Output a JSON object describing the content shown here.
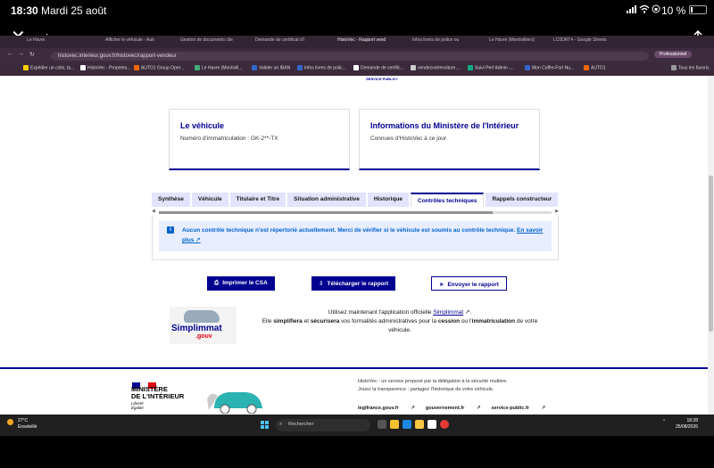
{
  "ios": {
    "time": "18:30",
    "date": "Mardi 25 août",
    "battery": "10 %"
  },
  "viewer": {
    "title": "image.png",
    "close": "✕",
    "share": "⇪"
  },
  "browser": {
    "tabs": [
      "Le Havre",
      "Afficher le véhicule - Autr",
      "Gestion de documents clie",
      "Demande de certificat d'i",
      "HistoVec - Rapport vend",
      "Infos livres de police ou",
      "Le Havre (Montivilliers)",
      "LC0DRT4 - Google Sheets"
    ],
    "url": "histovec.interieur.gouv.fr/histovec/rapport-vendeur",
    "profile": "Professionnel",
    "bookmarks": [
      "Expédier un colis, ta...",
      "HistoVec - Proprieta...",
      "AUTO1 Group Oper...",
      "Le Havre (Montivill...",
      "Valider un IBAN",
      "Infos livres de polic...",
      "Demande de certific...",
      "vendezvotrevoiture....",
      "Suivi Perf Admin -...",
      "Mon Coffre-Fort Nu...",
      "AUTO1",
      "Tous les favoris"
    ]
  },
  "page": {
    "top_logo": "SERVICE PUBLIC+",
    "card_vehicle": {
      "title": "Le véhicule",
      "text": "Numéro d'immatriculation : GK-2**-TX"
    },
    "card_ministry": {
      "title": "Informations du Ministère de l'Intérieur",
      "text": "Connues d'HistoVec à ce jour"
    },
    "tabs": [
      "Synthèse",
      "Véhicule",
      "Titulaire et Titre",
      "Situation administrative",
      "Historique",
      "Contrôles techniques",
      "Rappels constructeur"
    ],
    "active_tab": "Contrôles techniques",
    "alert": {
      "icon": "i",
      "text": "Aucun contrôle technique n'est répertorié actuellement. Merci de vérifier si le véhicule est soumis au contrôle technique.",
      "link": "En savoir plus"
    },
    "buttons": {
      "print": "Imprimer le CSA",
      "download": "Télécharger le rapport",
      "send": "Envoyer le rapport"
    },
    "simplimmat": {
      "logo": "Simplimmat",
      "logo_sub": ".gouv",
      "line1_pre": "Utilisez maintenant l'application officielle",
      "line1_link": "Simplimmat",
      "line2_a": "Elle",
      "line2_b": "simplifiera",
      "line2_c": "et",
      "line2_d": "sécurisera",
      "line2_e": "vos formalités administratives pour la",
      "line2_f": "cession",
      "line2_g": "ou l'",
      "line2_h": "immatriculation",
      "line2_i": "de votre véhicule."
    },
    "footer": {
      "ministry_line1": "MINISTÈRE",
      "ministry_line2": "DE L'INTÉRIEUR",
      "devise1": "Liberté",
      "devise2": "Égalité",
      "text1": "HistoVec : un service proposé par la délégation à la sécurité routière.",
      "text2": "Jouez la transparence : partagez l'historique de votre véhicule.",
      "links": [
        "legifrance.gouv.fr",
        "gouvernement.fr",
        "service-public.fr"
      ]
    }
  },
  "taskbar": {
    "temp": "27°C",
    "weather": "Ensoleillé",
    "search": "Rechercher",
    "time": "18:28",
    "date": "25/08/2026"
  },
  "colors": {
    "primary": "#000091",
    "info": "#0063cb",
    "info_bg": "#e8edff",
    "red": "#e1000f"
  }
}
